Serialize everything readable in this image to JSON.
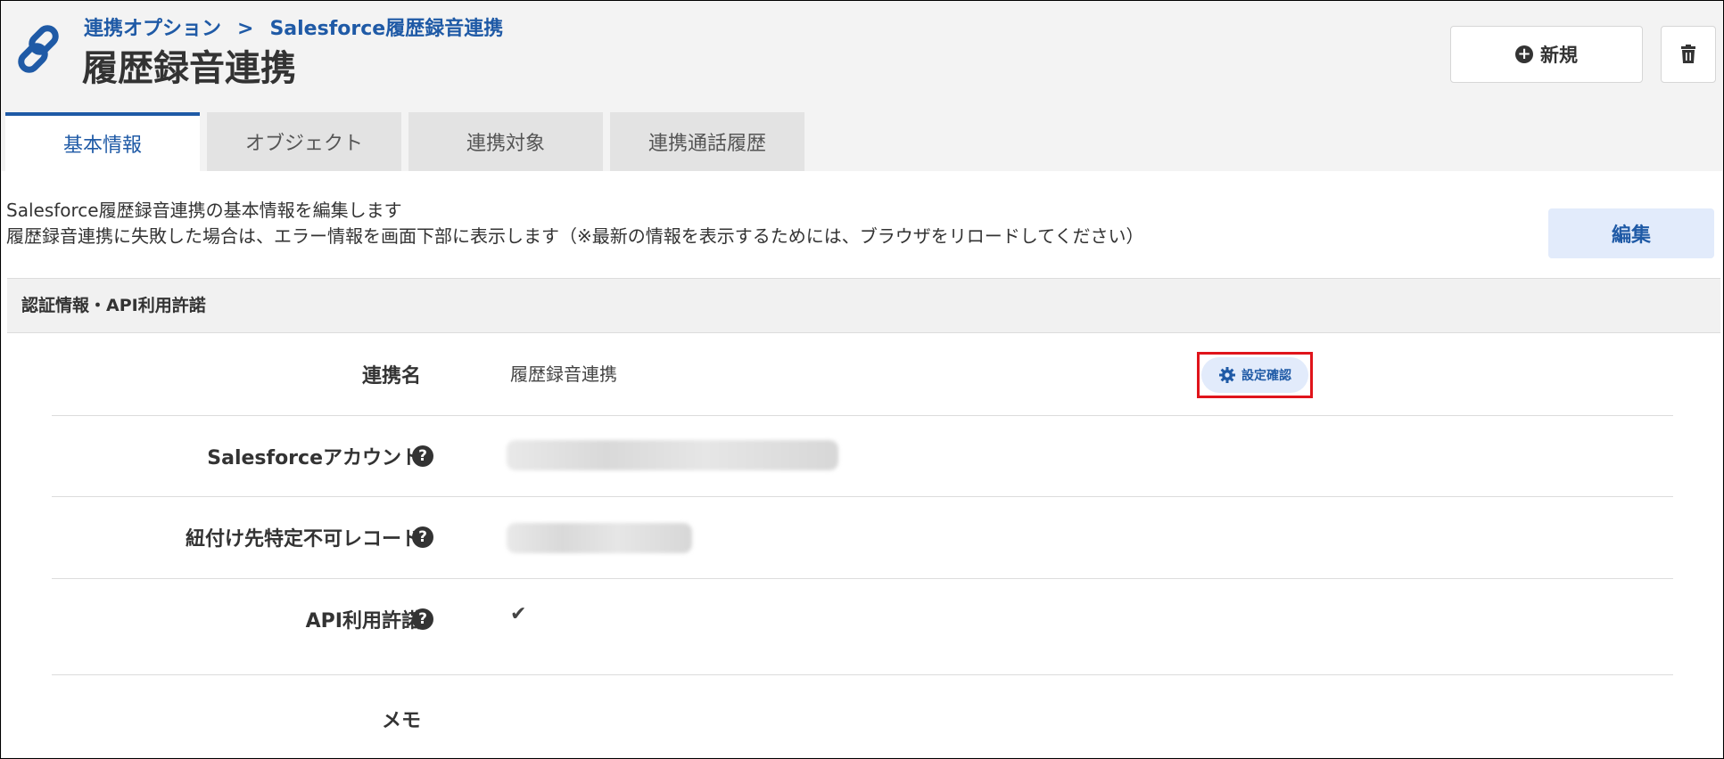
{
  "breadcrumb": {
    "parent": "連携オプション",
    "separator": ">",
    "current": "Salesforce履歴録音連携"
  },
  "header": {
    "title": "履歴録音連携",
    "new_label": "新規"
  },
  "tabs": [
    {
      "label": "基本情報",
      "active": true
    },
    {
      "label": "オブジェクト",
      "active": false
    },
    {
      "label": "連携対象",
      "active": false
    },
    {
      "label": "連携通話履歴",
      "active": false
    }
  ],
  "description": {
    "line1": "Salesforce履歴録音連携の基本情報を編集します",
    "line2": "履歴録音連携に失敗した場合は、エラー情報を画面下部に表示します（※最新の情報を表示するためには、ブラウザをリロードしてください）"
  },
  "edit_label": "編集",
  "section": {
    "title": "認証情報・API利用許諾",
    "rows": [
      {
        "label": "連携名",
        "value": "履歴録音連携",
        "confirm_label": "設定確認"
      },
      {
        "label": "Salesforceアカウント",
        "help": "?"
      },
      {
        "label": "紐付け先特定不可レコード",
        "help": "?"
      },
      {
        "label": "API利用許諾",
        "help": "?",
        "value": "✔"
      },
      {
        "label": "メモ"
      }
    ]
  },
  "colors": {
    "accent": "#1f5aa6",
    "highlight_border": "#e0141b",
    "button_bg": "#e2ebfb"
  },
  "icons": [
    "link-icon",
    "plus-circle-icon",
    "trash-icon",
    "gear-icon",
    "question-circle-icon",
    "check-icon"
  ]
}
